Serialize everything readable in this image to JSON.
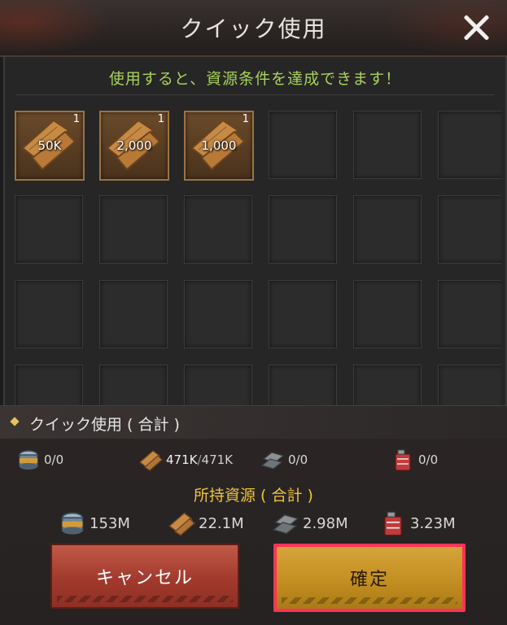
{
  "window": {
    "title": "クイック使用",
    "notice": "使用すると、資源条件を達成できます！"
  },
  "slots": [
    {
      "amount": "50K",
      "count": "1",
      "icon": "wood-plank-icon"
    },
    {
      "amount": "2,000",
      "count": "1",
      "icon": "wood-plank-icon"
    },
    {
      "amount": "1,000",
      "count": "1",
      "icon": "wood-plank-icon"
    }
  ],
  "summary": {
    "header": "クイック使用 ( 合計 )",
    "food": "0/0",
    "wood_used": "471K",
    "wood_required": "471K",
    "steel": "0/0",
    "oil": "0/0"
  },
  "owned": {
    "title": "所持資源 ( 合計 )",
    "food": "153M",
    "wood": "22.1M",
    "steel": "2.98M",
    "oil": "3.23M"
  },
  "buttons": {
    "cancel": "キャンセル",
    "confirm": "確定"
  },
  "colors": {
    "notice": "#a8d35a",
    "owned_title": "#f0c23a",
    "confirm_highlight": "#ff3355"
  }
}
